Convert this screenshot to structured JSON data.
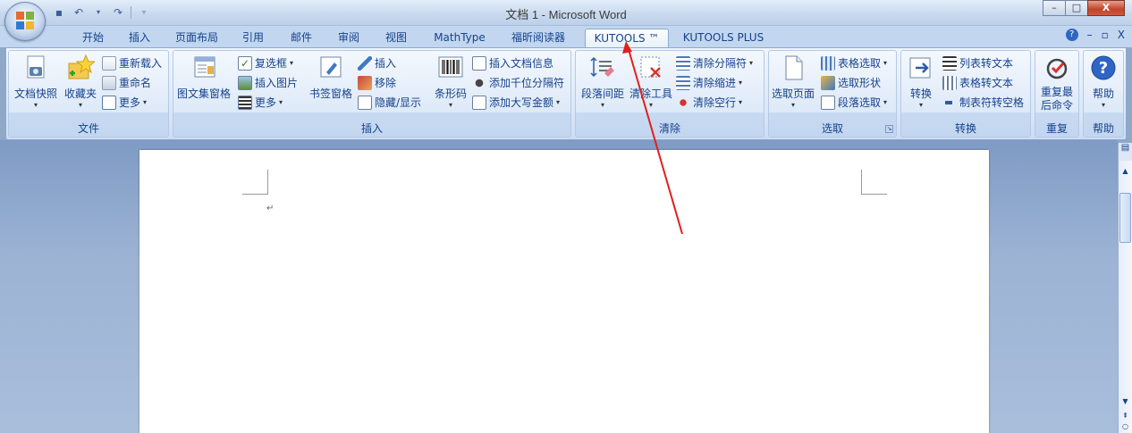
{
  "window": {
    "title": "文档 1 - Microsoft Word",
    "min": "–",
    "max": "□",
    "close": "X"
  },
  "tabs": [
    {
      "label": "开始"
    },
    {
      "label": "插入"
    },
    {
      "label": "页面布局"
    },
    {
      "label": "引用"
    },
    {
      "label": "邮件"
    },
    {
      "label": "审阅"
    },
    {
      "label": "视图"
    },
    {
      "label": "MathType"
    },
    {
      "label": "福昕阅读器"
    },
    {
      "label": "KUTOOLS ™"
    },
    {
      "label": "KUTOOLS PLUS"
    }
  ],
  "tab_right": {
    "help": "?",
    "min": "–",
    "restore": "▫",
    "close": "X"
  },
  "groups": {
    "wenjian": {
      "label": "文件",
      "snapshot": "文档快照",
      "favorites": "收藏夹",
      "reload": "重新载入",
      "rename": "重命名",
      "more": "更多"
    },
    "charu": {
      "label": "插入",
      "picwin": "图文集窗格",
      "checkbox": "复选框",
      "insert_pic": "插入图片",
      "more": "更多",
      "bookmark": "书签窗格",
      "ins": "插入",
      "move": "移除",
      "hide_show": "隐藏/显示",
      "barcode": "条形码",
      "doc_info": "插入文档信息",
      "thousand": "添加千位分隔符",
      "upper_amount": "添加大写金额"
    },
    "qingchu": {
      "label": "清除",
      "para_spacing": "段落间距",
      "clear_tools": "清除工具",
      "clear_sep": "清除分隔符",
      "clear_indent": "清除缩进",
      "clear_blank": "清除空行"
    },
    "xuanqu": {
      "label": "选取",
      "select_page": "选取页面",
      "table_sel": "表格选取",
      "shape_sel": "选取形状",
      "para_sel": "段落选取"
    },
    "zhuanhuan": {
      "label": "转换",
      "convert": "转换",
      "list_to_text": "列表转文本",
      "table_to_text": "表格转文本",
      "tab_to_space": "制表符转空格"
    },
    "chongfu": {
      "label": "重复",
      "repeat_line1": "重复最",
      "repeat_line2": "后命令"
    },
    "bangzhu": {
      "label": "帮助",
      "help": "帮助"
    }
  },
  "colors": {
    "annotation_arrow": "#e0201c",
    "ribbon_text": "#15428b"
  }
}
